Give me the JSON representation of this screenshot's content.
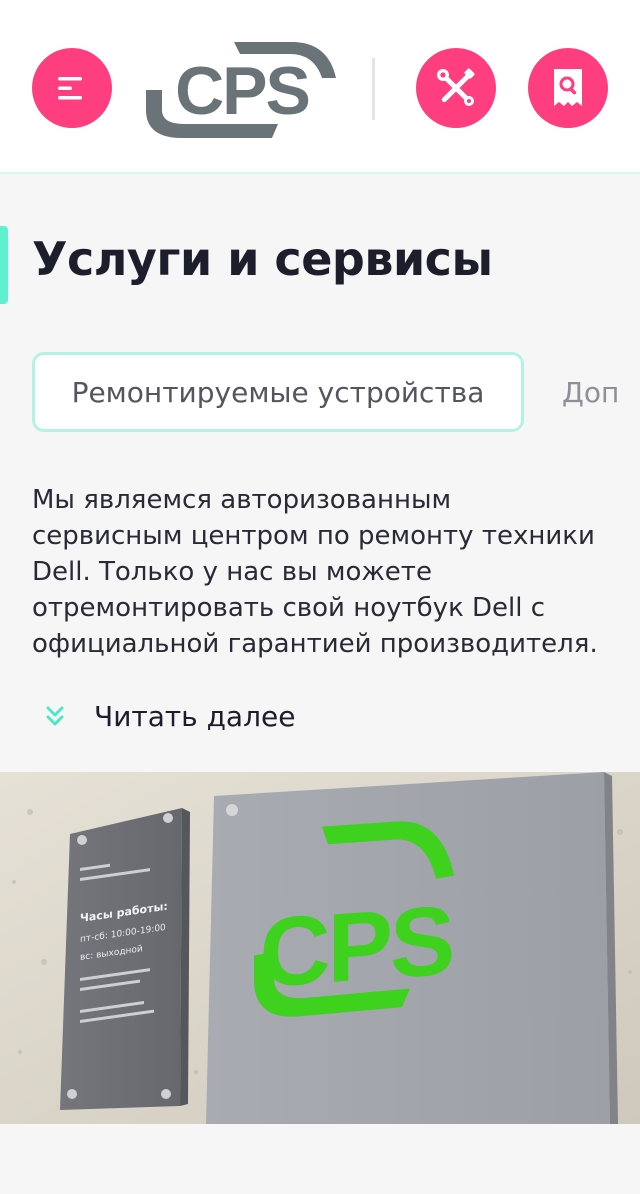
{
  "header": {
    "logo_text": "CPS",
    "menu_icon": "hamburger-menu-icon",
    "tools_icon": "wrench-screwdriver-icon",
    "receipt_icon": "receipt-search-icon",
    "accent_color": "#ff3e7f"
  },
  "page": {
    "title": "Услуги и сервисы",
    "accent_color": "#5ef0cf"
  },
  "tabs": [
    {
      "label": "Ремонтируемые устройства",
      "active": true
    },
    {
      "label": "Доп",
      "active": false
    }
  ],
  "description": "Мы являемся авторизованным сервисным центром по ремонту техники Dell. Только у нас вы можете отремонтировать свой ноутбук Dell с официальной гарантией производителя.",
  "read_more": {
    "label": "Читать далее",
    "icon": "double-chevron-down-icon"
  },
  "photo": {
    "sign_logo_text": "CPS",
    "plaque_heading": "Часы работы:",
    "plaque_lines": [
      "пт-сб: 10:00-19:00",
      "вс: выходной"
    ],
    "logo_color": "#3ed11e"
  }
}
